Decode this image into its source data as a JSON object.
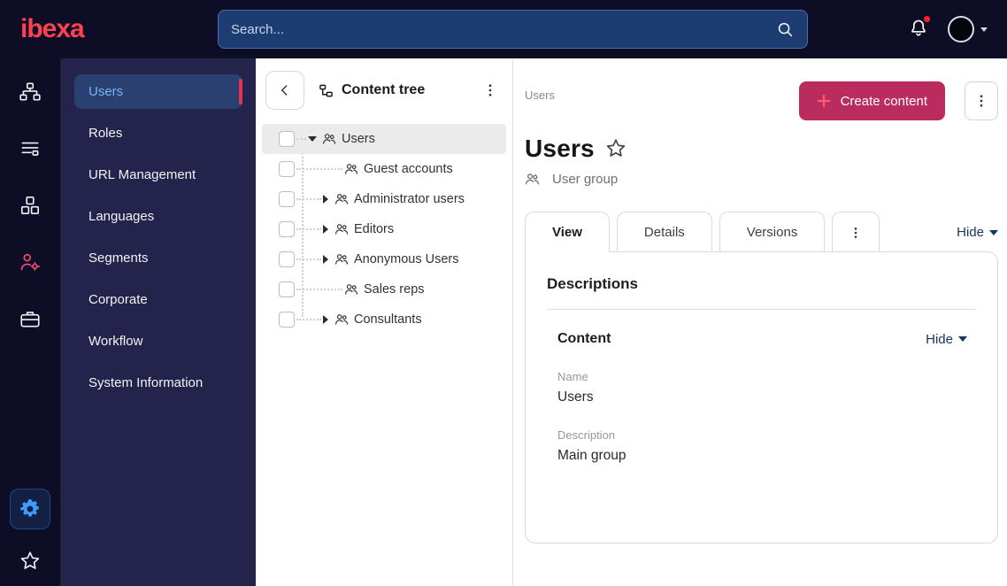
{
  "topbar": {
    "logo": "ibexa",
    "search_placeholder": "Search..."
  },
  "rail": {
    "icons": [
      "content-structure-icon",
      "admin-list-icon",
      "modules-icon",
      "user-settings-icon",
      "corporate-icon",
      "settings-gear-icon",
      "bookmarks-star-icon"
    ]
  },
  "sidebar": {
    "items": [
      {
        "label": "Users",
        "active": true
      },
      {
        "label": "Roles",
        "active": false
      },
      {
        "label": "URL Management",
        "active": false
      },
      {
        "label": "Languages",
        "active": false
      },
      {
        "label": "Segments",
        "active": false
      },
      {
        "label": "Corporate",
        "active": false
      },
      {
        "label": "Workflow",
        "active": false
      },
      {
        "label": "System Information",
        "active": false
      }
    ]
  },
  "content_tree": {
    "title": "Content tree",
    "items": [
      {
        "label": "Users",
        "level": 0,
        "expanded": true,
        "selected": true,
        "has_children": true
      },
      {
        "label": "Guest accounts",
        "level": 1,
        "has_children": false
      },
      {
        "label": "Administrator users",
        "level": 1,
        "has_children": true
      },
      {
        "label": "Editors",
        "level": 1,
        "has_children": true
      },
      {
        "label": "Anonymous Users",
        "level": 1,
        "has_children": true
      },
      {
        "label": "Sales reps",
        "level": 1,
        "has_children": false
      },
      {
        "label": "Consultants",
        "level": 1,
        "has_children": true
      }
    ]
  },
  "main": {
    "breadcrumb": "Users",
    "create_button_label": "Create content",
    "title": "Users",
    "content_type_label": "User group",
    "tabs": [
      {
        "label": "View",
        "active": true
      },
      {
        "label": "Details",
        "active": false
      },
      {
        "label": "Versions",
        "active": false
      }
    ],
    "hide_label": "Hide",
    "panel": {
      "heading": "Descriptions",
      "section": {
        "title": "Content",
        "hide_label": "Hide"
      },
      "fields": [
        {
          "label": "Name",
          "value": "Users"
        },
        {
          "label": "Description",
          "value": "Main group"
        }
      ]
    }
  },
  "colors": {
    "topbar_bg": "#0d0d26",
    "sidebar_bg": "#23234b",
    "selected_item_bg": "#2a4070",
    "selected_item_text": "#78b3f7",
    "selected_item_indicator": "#e13352",
    "accent_primary": "#bb2c5e",
    "active_rail_icon": "#3f9cff",
    "logo_red": "#ff4050",
    "notification_dot": "#ff2121",
    "search_bg": "#1d3c72"
  }
}
